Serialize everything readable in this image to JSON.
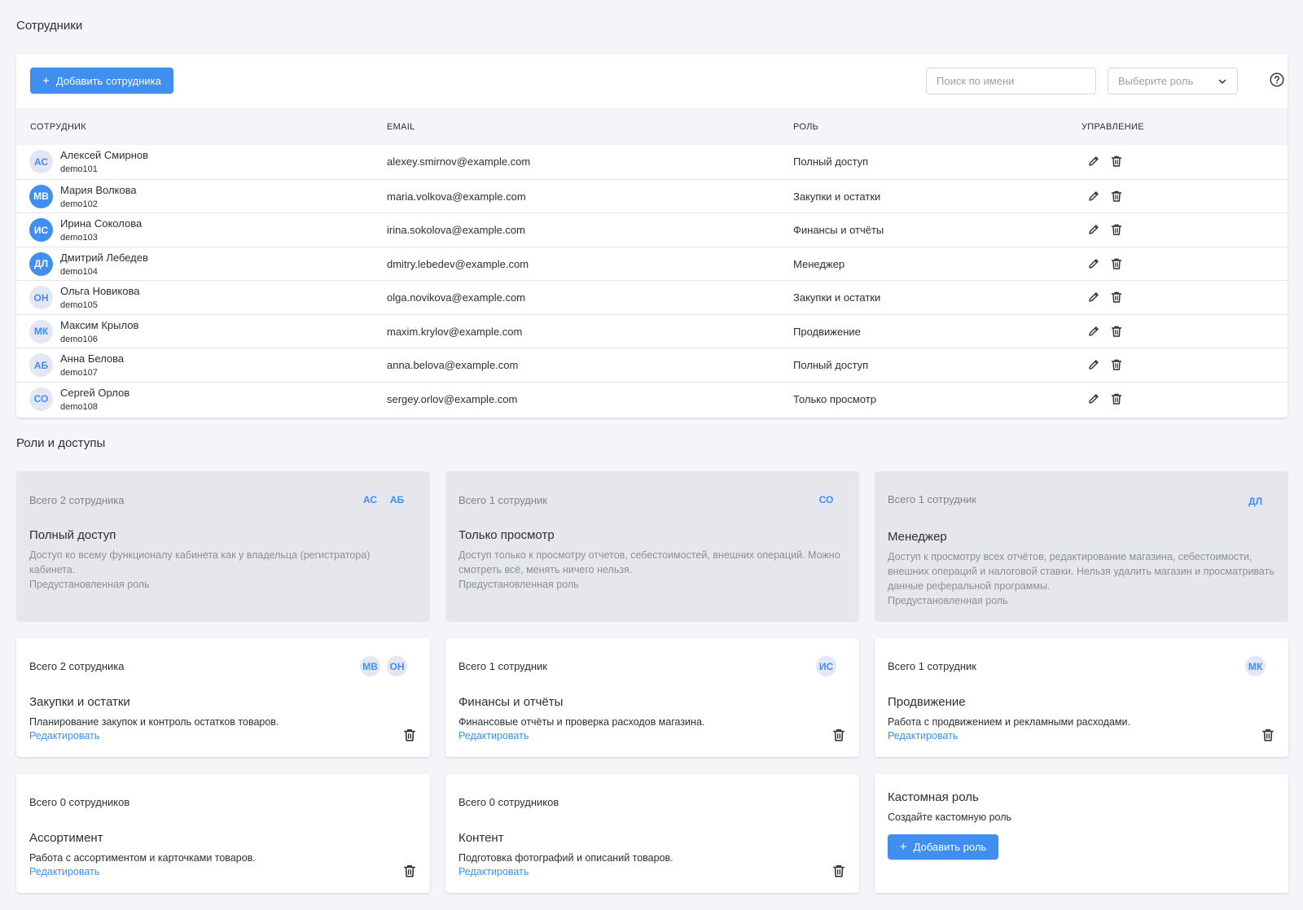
{
  "employees_section": {
    "title": "Сотрудники",
    "add_button_label": "Добавить сотрудника",
    "search_placeholder": "Поиск по имени",
    "role_select_placeholder": "Выберите роль",
    "columns": [
      "СОТРУДНИК",
      "EMAIL",
      "РОЛЬ",
      "УПРАВЛЕНИЕ"
    ],
    "rows": [
      {
        "initials": "АС",
        "name": "Алексей Смирнов",
        "login": "demo101",
        "email": "alexey.smirnov@example.com",
        "role": "Полный доступ",
        "avatar_style": "light"
      },
      {
        "initials": "МВ",
        "name": "Мария Волкова",
        "login": "demo102",
        "email": "maria.volkova@example.com",
        "role": "Закупки и остатки",
        "avatar_style": "dark"
      },
      {
        "initials": "ИС",
        "name": "Ирина Соколова",
        "login": "demo103",
        "email": "irina.sokolova@example.com",
        "role": "Финансы и отчёты",
        "avatar_style": "dark"
      },
      {
        "initials": "ДЛ",
        "name": "Дмитрий Лебедев",
        "login": "demo104",
        "email": "dmitry.lebedev@example.com",
        "role": "Менеджер",
        "avatar_style": "dark"
      },
      {
        "initials": "ОН",
        "name": "Ольга Новикова",
        "login": "demo105",
        "email": "olga.novikova@example.com",
        "role": "Закупки и остатки",
        "avatar_style": "light"
      },
      {
        "initials": "МК",
        "name": "Максим Крылов",
        "login": "demo106",
        "email": "maxim.krylov@example.com",
        "role": "Продвижение",
        "avatar_style": "light"
      },
      {
        "initials": "АБ",
        "name": "Анна Белова",
        "login": "demo107",
        "email": "anna.belova@example.com",
        "role": "Полный доступ",
        "avatar_style": "light"
      },
      {
        "initials": "СО",
        "name": "Сергей Орлов",
        "login": "demo108",
        "email": "sergey.orlov@example.com",
        "role": "Только просмотр",
        "avatar_style": "light"
      }
    ],
    "row_action_icons": [
      "pencil-icon",
      "trash-icon"
    ]
  },
  "roles_section": {
    "title": "Роли и доступы",
    "preset_roles": [
      {
        "count_text": "Всего 2 сотрудника",
        "members": [
          "АС",
          "АБ"
        ],
        "title": "Полный доступ",
        "description": "Доступ ко всему функционалу кабинета как у владельца (регистратора) кабинета.",
        "note": "Предустановленная роль"
      },
      {
        "count_text": "Всего 1 сотрудник",
        "members": [
          "СО"
        ],
        "title": "Только просмотр",
        "description": "Доступ только к просмотру отчетов, себестоимостей, внешних операций. Можно смотреть всё, менять ничего нельзя.",
        "note": "Предустановленная роль"
      },
      {
        "count_text": "Всего 1 сотрудник",
        "members": [
          "ДЛ"
        ],
        "title": "Менеджер",
        "description": "Доступ к просмотру всех отчётов, редактирование магазина, себестоимости, внешних операций и налоговой ставки. Нельзя удалить магазин и просматривать данные реферальной программы.",
        "note": "Предустановленная роль"
      }
    ],
    "custom_roles": [
      {
        "count_text": "Всего 2 сотрудника",
        "members": [
          "МВ",
          "ОН"
        ],
        "title": "Закупки и остатки",
        "description": "Планирование закупок и контроль остатков товаров.",
        "edit_label": "Редактировать"
      },
      {
        "count_text": "Всего 1 сотрудник",
        "members": [
          "ИС"
        ],
        "title": "Финансы и отчёты",
        "description": "Финансовые отчёты и проверка расходов магазина.",
        "edit_label": "Редактировать"
      },
      {
        "count_text": "Всего 1 сотрудник",
        "members": [
          "МК"
        ],
        "title": "Продвижение",
        "description": "Работа с продвижением и рекламными расходами.",
        "edit_label": "Редактировать"
      },
      {
        "count_text": "Всего 0 сотрудников",
        "members": [],
        "title": "Ассортимент",
        "description": "Работа с ассортиментом и карточками товаров.",
        "edit_label": "Редактировать"
      },
      {
        "count_text": "Всего 0 сотрудников",
        "members": [],
        "title": "Контент",
        "description": "Подготовка фотографий и описаний товаров.",
        "edit_label": "Редактировать"
      }
    ],
    "custom_role_card": {
      "title": "Кастомная роль",
      "description": "Создайте кастомную роль",
      "button_label": "Добавить роль"
    }
  },
  "colors": {
    "accent": "#3f8ef0",
    "page_bg": "#f4f5f9",
    "preset_card_bg": "#e6e7eb"
  }
}
